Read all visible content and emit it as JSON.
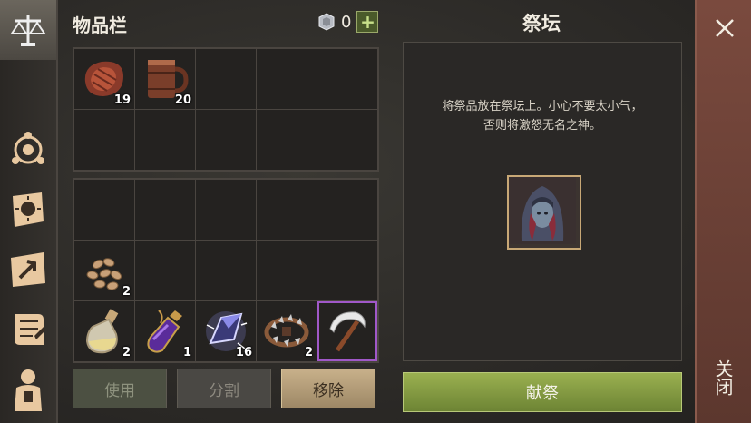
{
  "inventory": {
    "title": "物品栏",
    "currency": {
      "icon": "silver-coin-icon",
      "value": "0",
      "add_label": "+"
    },
    "grid_top": [
      {
        "icon": "raw-meat-icon",
        "qty": "19"
      },
      {
        "icon": "wooden-mug-icon",
        "qty": "20"
      },
      {
        "icon": "",
        "qty": ""
      },
      {
        "icon": "",
        "qty": ""
      },
      {
        "icon": "",
        "qty": ""
      },
      {
        "icon": "",
        "qty": ""
      },
      {
        "icon": "",
        "qty": ""
      },
      {
        "icon": "",
        "qty": ""
      },
      {
        "icon": "",
        "qty": ""
      },
      {
        "icon": "",
        "qty": ""
      }
    ],
    "grid_bottom": [
      {
        "icon": "",
        "qty": ""
      },
      {
        "icon": "",
        "qty": ""
      },
      {
        "icon": "",
        "qty": ""
      },
      {
        "icon": "",
        "qty": ""
      },
      {
        "icon": "",
        "qty": ""
      },
      {
        "icon": "seeds-icon",
        "qty": "2"
      },
      {
        "icon": "",
        "qty": ""
      },
      {
        "icon": "",
        "qty": ""
      },
      {
        "icon": "",
        "qty": ""
      },
      {
        "icon": "",
        "qty": ""
      },
      {
        "icon": "potion-flask-icon",
        "qty": "2"
      },
      {
        "icon": "purple-potion-icon",
        "qty": "1"
      },
      {
        "icon": "crystal-shard-icon",
        "qty": "16"
      },
      {
        "icon": "bear-trap-icon",
        "qty": "2"
      },
      {
        "icon": "sickle-icon",
        "qty": "",
        "selected": true
      }
    ],
    "buttons": {
      "use": "使用",
      "split": "分割",
      "remove": "移除"
    }
  },
  "altar": {
    "title": "祭坛",
    "description_line1": "将祭品放在祭坛上。小心不要太小气，",
    "description_line2": "否则将激怒无名之神。",
    "slot_icon": "hooded-figure-icon",
    "sacrifice_label": "献祭"
  },
  "sidebar": {
    "items": [
      "scales-icon",
      "crafting-icon",
      "sun-scroll-icon",
      "map-icon",
      "quest-scroll-icon",
      "character-icon"
    ]
  },
  "close": {
    "label": "关闭"
  },
  "colors": {
    "accent_green": "#8ca448",
    "selected_border": "#a058c8",
    "close_bar": "#6a4036"
  }
}
